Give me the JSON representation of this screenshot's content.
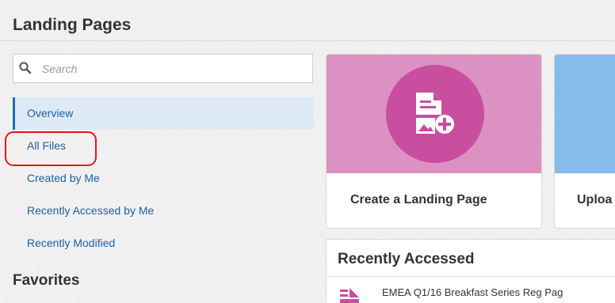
{
  "page": {
    "title": "Landing Pages"
  },
  "search": {
    "placeholder": "Search",
    "value": ""
  },
  "sidebar": {
    "items": [
      {
        "label": "Overview"
      },
      {
        "label": "All Files"
      },
      {
        "label": "Created by Me"
      },
      {
        "label": "Recently Accessed by Me"
      },
      {
        "label": "Recently Modified"
      }
    ],
    "active": "Overview",
    "favorites_heading": "Favorites"
  },
  "cards": [
    {
      "label": "Create a Landing Page",
      "color": "#db92c3",
      "icon": "create-landing-page-icon"
    },
    {
      "label": "Uploa",
      "color": "#85bcea"
    }
  ],
  "recent": {
    "title": "Recently Accessed",
    "items": [
      {
        "name": "EMEA Q1/16 Breakfast Series Reg Pag",
        "icon": "landing-page-icon"
      }
    ]
  },
  "colors": {
    "accent": "#1f6fb4",
    "highlight": "#e8121b",
    "create_circle": "#c94e9f"
  }
}
